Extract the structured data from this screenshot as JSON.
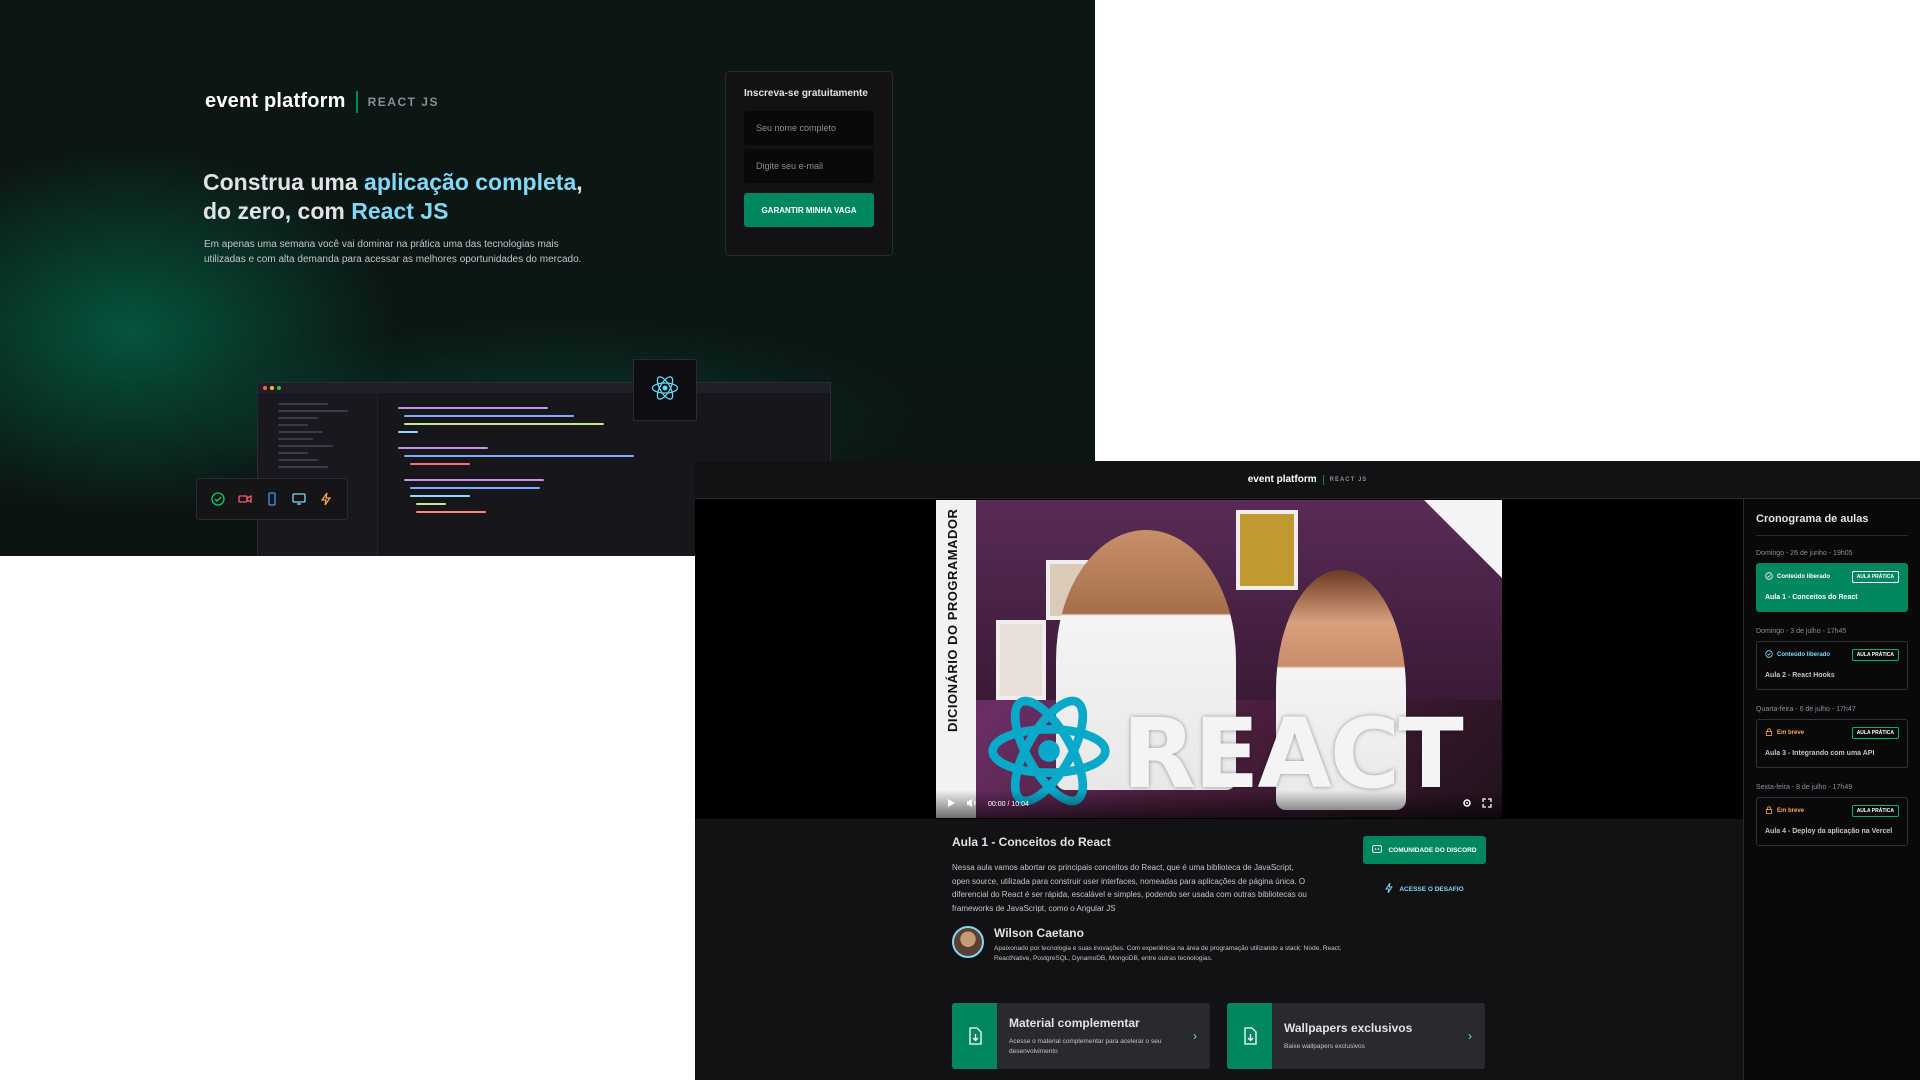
{
  "landing": {
    "logo": {
      "brand": "event platform",
      "tag": "REACT JS"
    },
    "headline": {
      "part1": "Construa uma ",
      "highlight1": "aplicação completa",
      "part2": ",",
      "part3": "do zero, com ",
      "highlight2": "React JS"
    },
    "subtitle": "Em apenas uma semana você vai dominar na prática uma das tecnologias mais utilizadas e com alta demanda para acessar as melhores oportunidades do mercado.",
    "signup": {
      "title": "Inscreva-se gratuitamente",
      "name_placeholder": "Seu nome completo",
      "email_placeholder": "Digite seu e-mail",
      "button": "GARANTIR MINHA VAGA"
    }
  },
  "lesson_page": {
    "header": {
      "brand": "event platform",
      "tag": "REACT JS"
    },
    "video": {
      "side_text": "DICIONÁRIO DO PROGRAMADOR",
      "overlay_word": "REACT",
      "time": "00:00 / 10:04"
    },
    "lesson": {
      "title": "Aula 1 - Conceitos do React",
      "description": "Nessa aula vamos abortar os principais conceitos do React, que é uma biblioteca de JavaScript, open source, utilizada para construir user interfaces, nomeadas para aplicações de página única. O diferencial do React é ser rápida, escalável e simples, podendo ser usada com outras bibliotecas ou frameworks de JavaScript, como o Angular JS"
    },
    "buttons": {
      "discord": "COMUNIDADE DO DISCORD",
      "challenge": "ACESSE O DESAFIO"
    },
    "author": {
      "name": "Wilson Caetano",
      "bio": "Apaixonado por tecnologia e suas inovações. Com experiência na área de programação utilizando a stack: Node, React, ReactNative, PostgreSQL, DynamoDB, MongoDB, entre outras tecnologias."
    },
    "cards": [
      {
        "title": "Material complementar",
        "desc": "Acesse o material complementar para acelerar o seu desenvolvimento"
      },
      {
        "title": "Wallpapers exclusivos",
        "desc": "Baixe wallpapers exclusivos"
      }
    ],
    "schedule": {
      "title": "Cronograma de aulas",
      "slots": [
        {
          "date": "Domingo - 26 de junho - 19h05",
          "status": "Conteúdo liberado",
          "kind": "AULA PRÁTICA",
          "name": "Aula 1 - Conceitos do React"
        },
        {
          "date": "Domingo - 3 de julho - 17h45",
          "status": "Conteúdo liberado",
          "kind": "AULA PRÁTICA",
          "name": "Aula 2 - React Hooks"
        },
        {
          "date": "Quarta-feira - 6 de julho - 17h47",
          "status": "Em breve",
          "kind": "AULA PRÁTICA",
          "name": "Aula 3 - Integrando com uma API"
        },
        {
          "date": "Sexta-feira - 8 de julho - 17h49",
          "status": "Em breve",
          "kind": "AULA PRÁTICA",
          "name": "Aula 4 - Deploy da aplicação na Vercel"
        }
      ]
    }
  },
  "colors": {
    "green": "#00875f",
    "blue": "#81d8f7",
    "orange": "#fba94c",
    "background": "#121214"
  },
  "icons": [
    "react-icon",
    "check-circle-icon",
    "video-icon",
    "mobile-icon",
    "monitor-icon",
    "lightning-icon",
    "play-icon",
    "volume-icon",
    "settings-icon",
    "fullscreen-icon",
    "discord-icon",
    "file-download-icon",
    "image-icon",
    "chevron-right-icon",
    "lock-icon"
  ]
}
